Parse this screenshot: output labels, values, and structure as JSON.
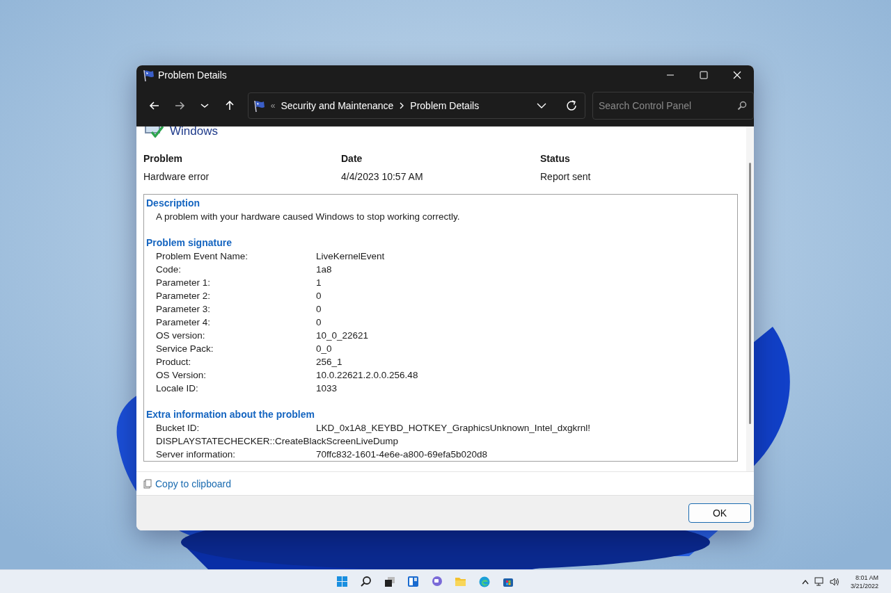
{
  "window": {
    "title": "Problem Details"
  },
  "address": {
    "overflow": "«",
    "breadcrumb": [
      "Security and Maintenance",
      "Problem Details"
    ]
  },
  "search": {
    "placeholder": "Search Control Panel"
  },
  "header": {
    "title": "Windows"
  },
  "summary": {
    "columns": [
      "Problem",
      "Date",
      "Status"
    ],
    "values": [
      "Hardware error",
      "4/4/2023 10:57 AM",
      "Report sent"
    ]
  },
  "details": [
    {
      "heading": "Description",
      "text": "A problem with your hardware caused Windows to stop working correctly."
    },
    {
      "heading": "Problem signature",
      "rows": [
        {
          "kind": "pair",
          "label": "Problem Event Name:",
          "value": "LiveKernelEvent"
        },
        {
          "kind": "pair",
          "label": "Code:",
          "value": "1a8"
        },
        {
          "kind": "pair",
          "label": "Parameter 1:",
          "value": "1"
        },
        {
          "kind": "pair",
          "label": "Parameter 2:",
          "value": "0"
        },
        {
          "kind": "pair",
          "label": "Parameter 3:",
          "value": "0"
        },
        {
          "kind": "pair",
          "label": "Parameter 4:",
          "value": "0"
        },
        {
          "kind": "pair",
          "label": "OS version:",
          "value": "10_0_22621"
        },
        {
          "kind": "pair",
          "label": "Service Pack:",
          "value": "0_0"
        },
        {
          "kind": "pair",
          "label": "Product:",
          "value": "256_1"
        },
        {
          "kind": "pair",
          "label": "OS Version:",
          "value": "10.0.22621.2.0.0.256.48"
        },
        {
          "kind": "pair",
          "label": "Locale ID:",
          "value": "1033"
        }
      ]
    },
    {
      "heading": "Extra information about the problem",
      "rows": [
        {
          "kind": "pair",
          "label": "Bucket ID:",
          "value": "LKD_0x1A8_KEYBD_HOTKEY_GraphicsUnknown_Intel_dxgkrnl!"
        },
        {
          "kind": "continuation",
          "label": "DISPLAYSTATECHECKER::CreateBlackScreenLiveDump"
        },
        {
          "kind": "pair",
          "label": "Server information:",
          "value": "70ffc832-1601-4e6e-a800-69efa5b020d8"
        }
      ]
    }
  ],
  "copy_link": "Copy to clipboard",
  "buttons": [
    "OK"
  ],
  "taskbar": {
    "time": "8:01 AM",
    "date": "3/21/2022"
  }
}
